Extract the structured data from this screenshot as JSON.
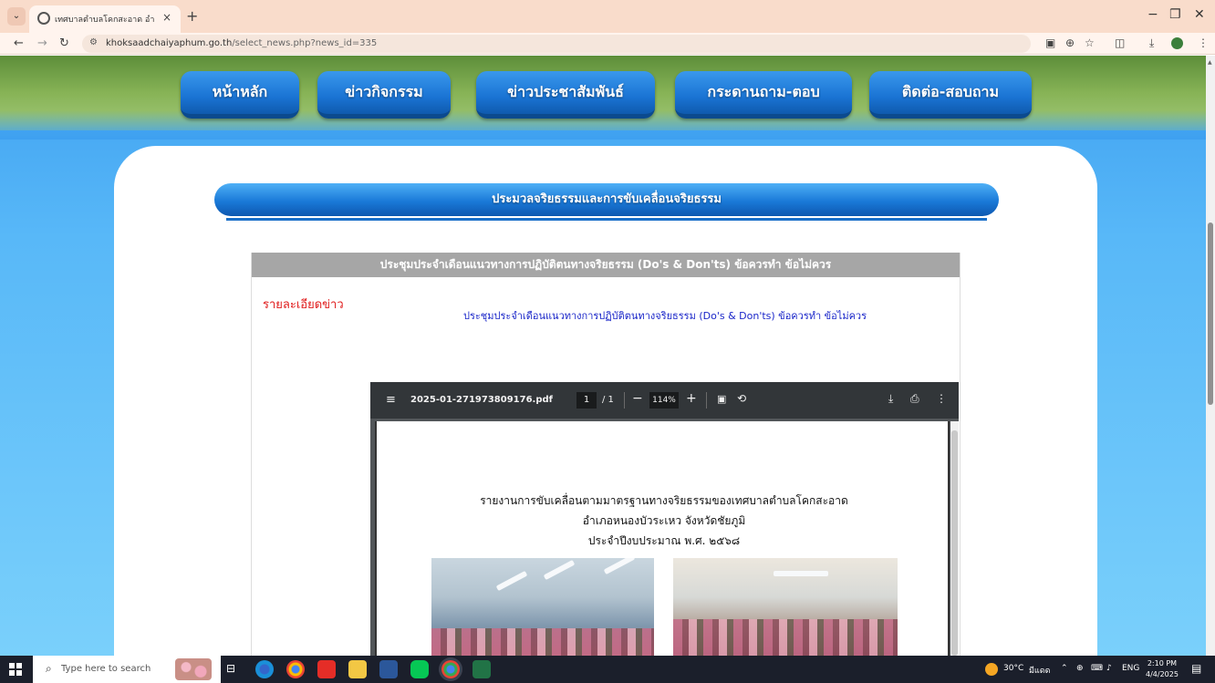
{
  "browser": {
    "tab_title": "เทศบาลตำบลโคกสะอาด อำเภอหนอง",
    "tab_close": "×",
    "new_tab": "+",
    "url_domain": "khoksaadchaiyaphum.go.th",
    "url_path": "/select_news.php?news_id=335",
    "controls": {
      "minimize": "−",
      "restore": "❐",
      "close": "✕"
    },
    "nav": {
      "back": "←",
      "forward": "→",
      "reload": "↻",
      "menu_chevron": "⌄"
    }
  },
  "site": {
    "nav": [
      {
        "label": "หน้าหลัก"
      },
      {
        "label": "ข่าวกิจกรรม"
      },
      {
        "label": "ข่าวประชาสัมพันธ์"
      },
      {
        "label": "กระดานถาม-ตอบ"
      },
      {
        "label": "ติดต่อ-สอบถาม"
      }
    ],
    "section_title": "ประมวลจริยธรรมและการขับเคลื่อนจริยธรรม",
    "article": {
      "header": "ประชุมประจำเดือนแนวทางการปฏิบัติตนทางจริยธรรม (Do's & Don'ts) ข้อควรทำ ข้อไม่ควร",
      "detail_label": "รายละเอียดข่าว",
      "summary": "ประชุมประจำเดือนแนวทางการปฏิบัติตนทางจริยธรรม (Do's & Don'ts) ข้อควรทำ ข้อไม่ควร"
    }
  },
  "pdf": {
    "filename": "2025-01-271973809176.pdf",
    "page_current": "1",
    "page_total": "/ 1",
    "zoom": "114%",
    "title_line1": "รายงานการขับเคลื่อนตามมาตรฐานทางจริยธรรมของเทศบาลตำบลโคกสะอาด",
    "title_line2": "อำเภอหนองบัวระเหว  จังหวัดชัยภูมิ",
    "title_line3": "ประจำปีงบประมาณ พ.ศ. ๒๕๖๘"
  },
  "taskbar": {
    "search_placeholder": "Type here to search",
    "weather": "30°C",
    "weather_desc": "มีแดด",
    "language": "ENG",
    "time": "2:10 PM",
    "date": "4/4/2025"
  }
}
